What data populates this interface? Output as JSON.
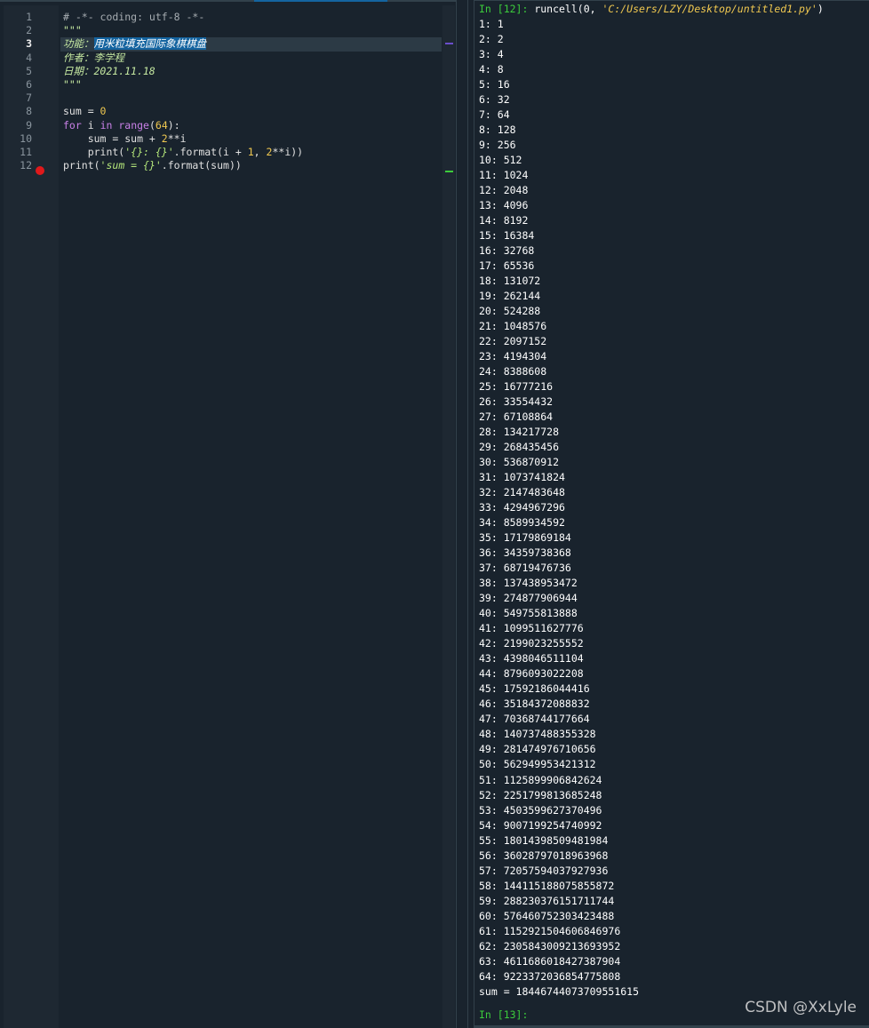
{
  "editor": {
    "line_numbers": [
      "1",
      "2",
      "3",
      "4",
      "5",
      "6",
      "7",
      "8",
      "9",
      "10",
      "11",
      "12"
    ],
    "lines": [
      {
        "parts": [
          {
            "cls": "c-comment",
            "text": "# -*- coding: utf-8 -*-"
          }
        ]
      },
      {
        "parts": [
          {
            "cls": "c-doc",
            "text": "\"\"\""
          }
        ]
      },
      {
        "parts": [
          {
            "cls": "c-doc",
            "text": "功能："
          },
          {
            "cls": "c-sel",
            "text": "用米粒填充国际象棋棋盘"
          }
        ]
      },
      {
        "parts": [
          {
            "cls": "c-doc",
            "text": "作者：李学程"
          }
        ]
      },
      {
        "parts": [
          {
            "cls": "c-doc",
            "text": "日期：2021.11.18"
          }
        ]
      },
      {
        "parts": [
          {
            "cls": "c-doc",
            "text": "\"\"\""
          }
        ]
      },
      {
        "parts": []
      },
      {
        "parts": [
          {
            "cls": "",
            "text": "sum = "
          },
          {
            "cls": "c-num",
            "text": "0"
          }
        ]
      },
      {
        "parts": [
          {
            "cls": "c-kw",
            "text": "for"
          },
          {
            "cls": "",
            "text": " i "
          },
          {
            "cls": "c-kw",
            "text": "in"
          },
          {
            "cls": "",
            "text": " "
          },
          {
            "cls": "c-kw",
            "text": "range"
          },
          {
            "cls": "",
            "text": "("
          },
          {
            "cls": "c-num",
            "text": "64"
          },
          {
            "cls": "",
            "text": "):"
          }
        ]
      },
      {
        "parts": [
          {
            "cls": "",
            "text": "    sum = sum + "
          },
          {
            "cls": "c-num",
            "text": "2"
          },
          {
            "cls": "",
            "text": "**i"
          }
        ]
      },
      {
        "parts": [
          {
            "cls": "",
            "text": "    print("
          },
          {
            "cls": "c-str",
            "text": "'{}: {}'"
          },
          {
            "cls": "",
            "text": ".format(i + "
          },
          {
            "cls": "c-num",
            "text": "1"
          },
          {
            "cls": "",
            "text": ", "
          },
          {
            "cls": "c-num",
            "text": "2"
          },
          {
            "cls": "",
            "text": "**i))"
          }
        ]
      },
      {
        "parts": [
          {
            "cls": "",
            "text": "print("
          },
          {
            "cls": "c-str",
            "text": "'sum = {}'"
          },
          {
            "cls": "",
            "text": ".format(sum))"
          }
        ]
      }
    ],
    "current_line": 3,
    "breakpoint_line": 12
  },
  "console": {
    "command_prompt": "In [12]:",
    "command_code": " runcell(0, ",
    "command_path": "'C:/Users/LZY/Desktop/untitled1.py'",
    "command_end": ")",
    "output": [
      "1: 1",
      "2: 2",
      "3: 4",
      "4: 8",
      "5: 16",
      "6: 32",
      "7: 64",
      "8: 128",
      "9: 256",
      "10: 512",
      "11: 1024",
      "12: 2048",
      "13: 4096",
      "14: 8192",
      "15: 16384",
      "16: 32768",
      "17: 65536",
      "18: 131072",
      "19: 262144",
      "20: 524288",
      "21: 1048576",
      "22: 2097152",
      "23: 4194304",
      "24: 8388608",
      "25: 16777216",
      "26: 33554432",
      "27: 67108864",
      "28: 134217728",
      "29: 268435456",
      "30: 536870912",
      "31: 1073741824",
      "32: 2147483648",
      "33: 4294967296",
      "34: 8589934592",
      "35: 17179869184",
      "36: 34359738368",
      "37: 68719476736",
      "38: 137438953472",
      "39: 274877906944",
      "40: 549755813888",
      "41: 1099511627776",
      "42: 2199023255552",
      "43: 4398046511104",
      "44: 8796093022208",
      "45: 17592186044416",
      "46: 35184372088832",
      "47: 70368744177664",
      "48: 140737488355328",
      "49: 281474976710656",
      "50: 562949953421312",
      "51: 1125899906842624",
      "52: 2251799813685248",
      "53: 4503599627370496",
      "54: 9007199254740992",
      "55: 18014398509481984",
      "56: 36028797018963968",
      "57: 72057594037927936",
      "58: 144115188075855872",
      "59: 288230376151711744",
      "60: 576460752303423488",
      "61: 1152921504606846976",
      "62: 2305843009213693952",
      "63: 4611686018427387904",
      "64: 9223372036854775808",
      "sum = 18446744073709551615"
    ],
    "next_prompt": "In [13]:"
  },
  "watermark": "CSDN @XxLyle"
}
